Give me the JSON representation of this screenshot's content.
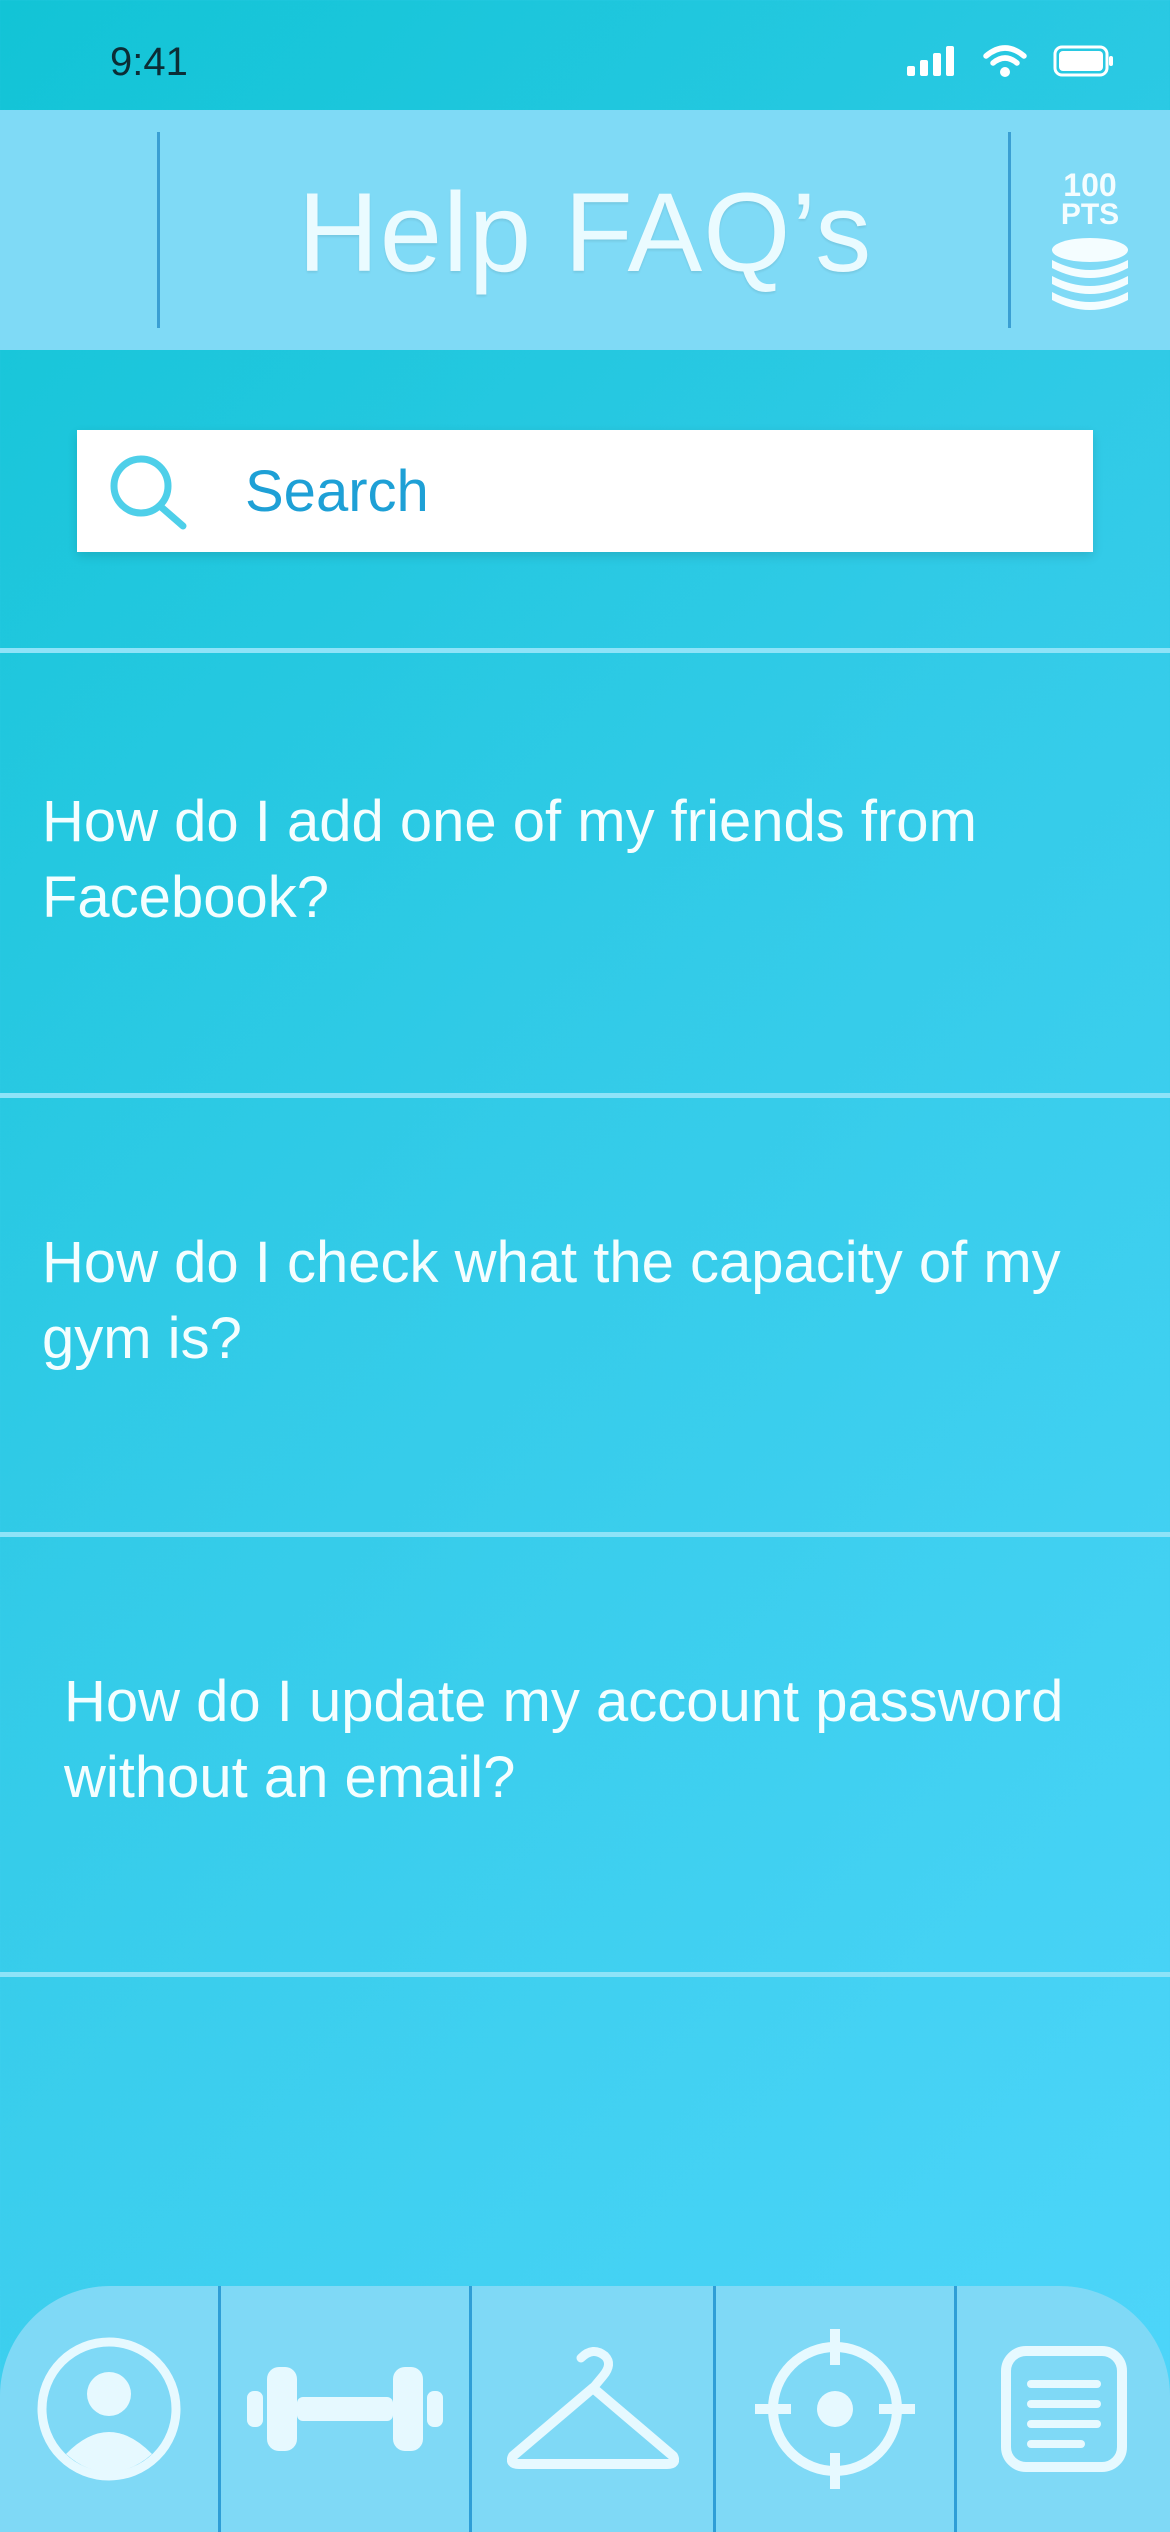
{
  "status_bar": {
    "time": "9:41"
  },
  "header": {
    "title": "Help FAQ’s",
    "points_amount": "100",
    "points_unit": "PTS"
  },
  "search": {
    "placeholder": "Search"
  },
  "faqs": [
    {
      "question": "How do I add one of my friends from Facebook?"
    },
    {
      "question": "How do I check what the capacity of my gym is?"
    },
    {
      "question": "How do I update my account password without an email?"
    }
  ],
  "icons": {
    "status": [
      "signal-icon",
      "wifi-icon",
      "battery-icon"
    ],
    "header": [
      "coins-icon"
    ],
    "search": "search-icon",
    "nav": [
      "profile-icon",
      "dumbbell-icon",
      "hanger-icon",
      "target-icon",
      "menu-list-icon"
    ]
  },
  "colors": {
    "background_start": "#12c4d6",
    "background_end": "#4fd6fb",
    "header_bg": "#7fdaf6",
    "search_text": "#1ea0d6",
    "divider": "#3a9fd3"
  }
}
